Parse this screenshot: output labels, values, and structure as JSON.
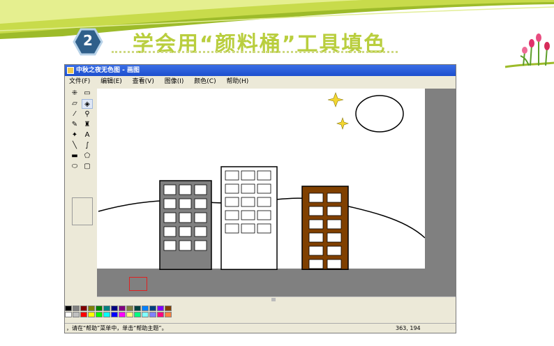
{
  "slide": {
    "number": "2",
    "title": "学会用“颜料桶”工具填色"
  },
  "window": {
    "title": "中秋之夜无色图 - 画图",
    "menus": [
      "文件(F)",
      "编辑(E)",
      "查看(V)",
      "图像(I)",
      "颜色(C)",
      "帮助(H)"
    ]
  },
  "tools": [
    {
      "name": "free-select-icon",
      "glyph": "⁜"
    },
    {
      "name": "rect-select-icon",
      "glyph": "▭"
    },
    {
      "name": "eraser-icon",
      "glyph": "▱"
    },
    {
      "name": "fill-bucket-icon",
      "glyph": "◈"
    },
    {
      "name": "color-picker-icon",
      "glyph": "⁄"
    },
    {
      "name": "magnifier-icon",
      "glyph": "⚲"
    },
    {
      "name": "pencil-icon",
      "glyph": "✎"
    },
    {
      "name": "brush-icon",
      "glyph": "♜"
    },
    {
      "name": "airbrush-icon",
      "glyph": "✦"
    },
    {
      "name": "text-icon",
      "glyph": "A"
    },
    {
      "name": "line-icon",
      "glyph": "╲"
    },
    {
      "name": "curve-icon",
      "glyph": "∫"
    },
    {
      "name": "rectangle-icon",
      "glyph": "▬"
    },
    {
      "name": "polygon-icon",
      "glyph": "⬠"
    },
    {
      "name": "ellipse-icon",
      "glyph": "⬭"
    },
    {
      "name": "rounded-rect-icon",
      "glyph": "▢"
    }
  ],
  "selected_tool": "fill-bucket-icon",
  "palette": {
    "top": [
      "#000000",
      "#808080",
      "#800000",
      "#808000",
      "#008000",
      "#008080",
      "#000080",
      "#800080",
      "#808040",
      "#004040",
      "#0080ff",
      "#004080",
      "#8000ff",
      "#804000"
    ],
    "bottom": [
      "#ffffff",
      "#c0c0c0",
      "#ff0000",
      "#ffff00",
      "#00ff00",
      "#00ffff",
      "#0000ff",
      "#ff00ff",
      "#ffff80",
      "#00ff80",
      "#80ffff",
      "#8080ff",
      "#ff0080",
      "#ff8040"
    ]
  },
  "buildings": {
    "left_fill": "#808080",
    "middle_fill": "#ffffff",
    "right_fill": "#804000"
  },
  "status": {
    "help_text": "，请在“帮助”菜单中，单击“帮助主题”。",
    "coords": "363, 194"
  }
}
